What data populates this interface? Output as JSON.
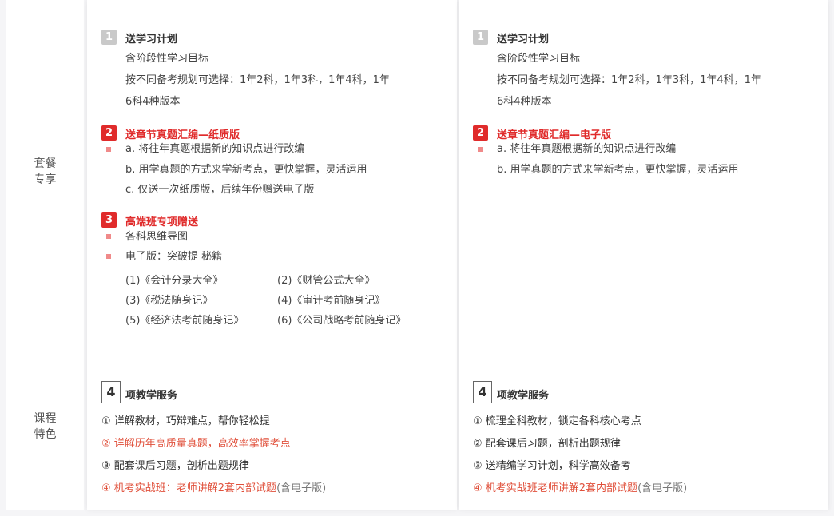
{
  "labels": {
    "package": [
      "套餐",
      "专享"
    ],
    "features": [
      "课程",
      "特色"
    ]
  },
  "left": {
    "sec1": {
      "num": "1",
      "title": "送学习计划",
      "lines": [
        "含阶段性学习目标",
        "按不同备考规划可选择：1年2科，1年3科，1年4科，1年",
        "6科4种版本"
      ]
    },
    "sec2": {
      "num": "2",
      "title": "送章节真题汇编—纸质版",
      "lines": [
        "a. 将往年真题根据新的知识点进行改编",
        "b. 用学真题的方式来学新考点，更快掌握，灵活运用",
        "c. 仅送一次纸质版，后续年份赠送电子版"
      ]
    },
    "sec3": {
      "num": "3",
      "title": "高端班专项赠送",
      "lines": [
        "各科思维导图",
        "电子版：突破提   秘籍"
      ],
      "books": [
        "(1)《会计分录大全》",
        "(2)《财管公式大全》",
        "(3)《税法随身记》",
        "(4)《审计考前随身记》",
        "(5)《经济法考前随身记》",
        "(6)《公司战略考前随身记》"
      ]
    },
    "features": {
      "num": "4",
      "title": "项教学服务",
      "items": [
        "① 详解教材，巧辩难点，帮你轻松提",
        "② 详解历年高质量真题，高效率掌握考点",
        "③ 配套课后习题，剖析出题规律",
        "④ 机考实战班：老师讲解2套内部试题"
      ],
      "suffix": "(含电子版)"
    }
  },
  "right": {
    "sec1": {
      "num": "1",
      "title": "送学习计划",
      "lines": [
        "含阶段性学习目标",
        "按不同备考规划可选择：1年2科，1年3科，1年4科，1年",
        "6科4种版本"
      ]
    },
    "sec2": {
      "num": "2",
      "title": "送章节真题汇编—电子版",
      "lines": [
        "a. 将往年真题根据新的知识点进行改编",
        "b. 用学真题的方式来学新考点，更快掌握，灵活运用"
      ]
    },
    "features": {
      "num": "4",
      "title": "项教学服务",
      "items": [
        "① 梳理全科教材，锁定各科核心考点",
        "② 配套课后习题，剖析出题规律",
        "③ 送精编学习计划，科学高效备考",
        "④ 机考实战班老师讲解2套内部试题"
      ],
      "suffix": "(含电子版)"
    }
  },
  "colors": {
    "accent_red": "#e02b2b",
    "grey_badge": "#c9c9c9",
    "bullet": "#f08a8a"
  }
}
